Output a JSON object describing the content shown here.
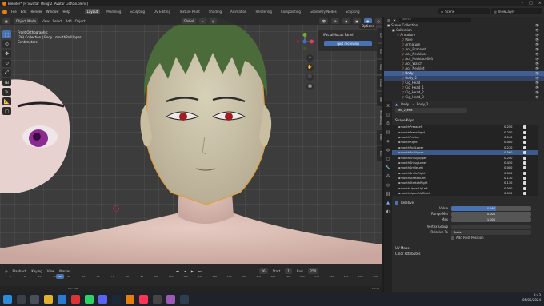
{
  "window": {
    "title": "Blender* [H:\\Avatar Thing\\2. Avatar List\\Go.blend]"
  },
  "menus": [
    "File",
    "Edit",
    "Render",
    "Window",
    "Help"
  ],
  "workspaces": [
    {
      "label": "Layout",
      "active": true
    },
    {
      "label": "Modeling"
    },
    {
      "label": "Sculpting"
    },
    {
      "label": "UV Editing"
    },
    {
      "label": "Texture Paint"
    },
    {
      "label": "Shading"
    },
    {
      "label": "Animation"
    },
    {
      "label": "Rendering"
    },
    {
      "label": "Compositing"
    },
    {
      "label": "Geometry Nodes"
    },
    {
      "label": "Scripting"
    }
  ],
  "scene": {
    "label": "Scene",
    "view_layer": "ViewLayer"
  },
  "viewport": {
    "mode": "Object Mode",
    "menu": [
      "View",
      "Select",
      "Add",
      "Object"
    ],
    "transform": "Global",
    "info": [
      "Front Orthographic",
      "(26) Collection | Body : mouthRollUpper",
      "Centimeters"
    ],
    "options": "Options",
    "sidebar_tabs": [
      "Item",
      "Tool",
      "View",
      "Create",
      "VRM",
      "iFacialMocap",
      "MMD",
      "Misc"
    ]
  },
  "ifacial_panel": {
    "title": "iFacialMocap Panel",
    "button": "quit receiving"
  },
  "timeline": {
    "menu": [
      "Playback",
      "Keying",
      "View",
      "Marker"
    ],
    "current_frame": "26",
    "start_label": "Start",
    "start": "1",
    "end_label": "End",
    "end": "250",
    "ruler": [
      "0",
      "10",
      "20",
      "30",
      "40",
      "50",
      "60",
      "70",
      "80",
      "90",
      "100",
      "110",
      "120",
      "130",
      "140",
      "150",
      "160",
      "170",
      "180",
      "190",
      "200",
      "210",
      "220",
      "230",
      "240",
      "250"
    ]
  },
  "status": {
    "hint": "Pan View",
    "version": "3.6.11"
  },
  "outliner": {
    "search_placeholder": "Search",
    "rows": [
      {
        "label": "Scene Collection",
        "indent": 0
      },
      {
        "label": "Collection",
        "indent": 1
      },
      {
        "label": "Armature",
        "indent": 2
      },
      {
        "label": "Pose",
        "indent": 3
      },
      {
        "label": "Armature",
        "indent": 3
      },
      {
        "label": "Acc_Bracelet",
        "indent": 3
      },
      {
        "label": "Acc_Necklace",
        "indent": 3
      },
      {
        "label": "Acc_Necklace001",
        "indent": 3
      },
      {
        "label": "Acc_Watch",
        "indent": 3
      },
      {
        "label": "Acc_Necklet",
        "indent": 3
      },
      {
        "label": "Body",
        "indent": 3,
        "state": "active"
      },
      {
        "label": "Body_2",
        "indent": 3,
        "state": "highlight"
      },
      {
        "label": "Cig_Head",
        "indent": 3
      },
      {
        "label": "Cig_Head_1",
        "indent": 3
      },
      {
        "label": "Cig_Head_2",
        "indent": 3
      },
      {
        "label": "Cig_Head_3",
        "indent": 3
      }
    ]
  },
  "properties": {
    "object": "Body",
    "mesh": "Body_2",
    "data_name": "Tail_2_end",
    "section_shape_keys": "Shape Keys",
    "shape_keys": [
      {
        "name": "mouthPressLeft",
        "value": "0.250"
      },
      {
        "name": "mouthPressRight",
        "value": "0.250"
      },
      {
        "name": "mouthPucker",
        "value": "0.040"
      },
      {
        "name": "mouthRight",
        "value": "0.000"
      },
      {
        "name": "mouthRollLower",
        "value": "0.270"
      },
      {
        "name": "mouthRollUpper",
        "value": "0.560",
        "selected": true
      },
      {
        "name": "mouthShrugUpper",
        "value": "0.250"
      },
      {
        "name": "mouthShrugLower",
        "value": "0.410"
      },
      {
        "name": "mouthSmileLeft",
        "value": "0.000"
      },
      {
        "name": "mouthSmileRight",
        "value": "0.000"
      },
      {
        "name": "mouthStretchLeft",
        "value": "0.130"
      },
      {
        "name": "mouthStretchRight",
        "value": "0.110"
      },
      {
        "name": "mouthUpperUpLeft",
        "value": "0.000"
      },
      {
        "name": "mouthUpperUpRight",
        "value": "0.070"
      }
    ],
    "relative_label": "Relative",
    "value_label": "Value",
    "value": "0.560",
    "range_min_label": "Range Min",
    "range_min": "0.000",
    "max_label": "Max",
    "max": "1.000",
    "vertex_group_label": "Vertex Group",
    "relative_to_label": "Relative To",
    "relative_to": "Basis",
    "add_rest": "Add Rest Position",
    "section_uv": "UV Maps",
    "section_color": "Color Attributes"
  },
  "taskbar": {
    "time": "3:43",
    "date": "05/06/2024"
  },
  "colors": {
    "accent": "#4772b3",
    "selection": "#3c5a8c",
    "blender_orange": "#e87d0d"
  }
}
